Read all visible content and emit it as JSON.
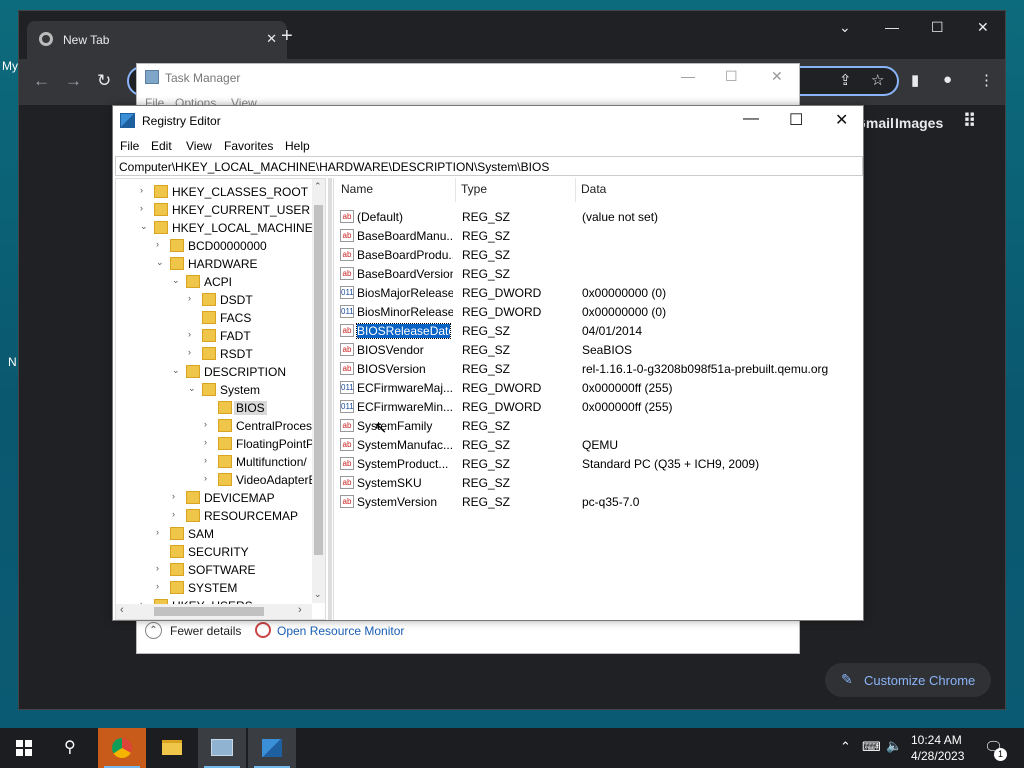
{
  "desktop": {
    "left_fragments": [
      "My",
      "N"
    ]
  },
  "chrome": {
    "tab_title": "New Tab",
    "tab_close": "✕",
    "new_tab": "+",
    "links": [
      "Gmail",
      "Images"
    ],
    "customize_label": "Customize Chrome"
  },
  "task_manager": {
    "title": "Task Manager",
    "menu": [
      "File",
      "Options",
      "View"
    ],
    "fewer_details": "Fewer details",
    "open_resource_monitor": "Open Resource Monitor"
  },
  "regedit": {
    "title": "Registry Editor",
    "menu": [
      "File",
      "Edit",
      "View",
      "Favorites",
      "Help"
    ],
    "address": "Computer\\HKEY_LOCAL_MACHINE\\HARDWARE\\DESCRIPTION\\System\\BIOS",
    "tree": [
      {
        "label": "HKEY_CLASSES_ROOT",
        "exp": "›"
      },
      {
        "label": "HKEY_CURRENT_USER",
        "exp": "›"
      },
      {
        "label": "HKEY_LOCAL_MACHINE",
        "exp": "⌄"
      },
      {
        "label": "BCD00000000",
        "exp": "›"
      },
      {
        "label": "HARDWARE",
        "exp": "⌄"
      },
      {
        "label": "ACPI",
        "exp": "⌄"
      },
      {
        "label": "DSDT",
        "exp": "›"
      },
      {
        "label": "FACS",
        "exp": ""
      },
      {
        "label": "FADT",
        "exp": "›"
      },
      {
        "label": "RSDT",
        "exp": "›"
      },
      {
        "label": "DESCRIPTION",
        "exp": "⌄"
      },
      {
        "label": "System",
        "exp": "⌄"
      },
      {
        "label": "BIOS",
        "exp": ""
      },
      {
        "label": "CentralProcess",
        "exp": "›"
      },
      {
        "label": "FloatingPointP",
        "exp": "›"
      },
      {
        "label": "Multifunction/",
        "exp": "›"
      },
      {
        "label": "VideoAdapterB",
        "exp": "›"
      },
      {
        "label": "DEVICEMAP",
        "exp": "›"
      },
      {
        "label": "RESOURCEMAP",
        "exp": "›"
      },
      {
        "label": "SAM",
        "exp": "›"
      },
      {
        "label": "SECURITY",
        "exp": ""
      },
      {
        "label": "SOFTWARE",
        "exp": "›"
      },
      {
        "label": "SYSTEM",
        "exp": "›"
      },
      {
        "label": "HKEY_USERS",
        "exp": "›"
      }
    ],
    "columns": {
      "name": "Name",
      "type": "Type",
      "data": "Data"
    },
    "values": [
      {
        "name": "(Default)",
        "type": "REG_SZ",
        "data": "(value not set)",
        "icon": "ab"
      },
      {
        "name": "BaseBoardManu...",
        "type": "REG_SZ",
        "data": "",
        "icon": "ab"
      },
      {
        "name": "BaseBoardProdu...",
        "type": "REG_SZ",
        "data": "",
        "icon": "ab"
      },
      {
        "name": "BaseBoardVersion",
        "type": "REG_SZ",
        "data": "",
        "icon": "ab"
      },
      {
        "name": "BiosMajorRelease",
        "type": "REG_DWORD",
        "data": "0x00000000 (0)",
        "icon": "011"
      },
      {
        "name": "BiosMinorRelease",
        "type": "REG_DWORD",
        "data": "0x00000000 (0)",
        "icon": "011"
      },
      {
        "name": "BIOSReleaseDate",
        "type": "REG_SZ",
        "data": "04/01/2014",
        "icon": "ab"
      },
      {
        "name": "BIOSVendor",
        "type": "REG_SZ",
        "data": "SeaBIOS",
        "icon": "ab"
      },
      {
        "name": "BIOSVersion",
        "type": "REG_SZ",
        "data": "rel-1.16.1-0-g3208b098f51a-prebuilt.qemu.org",
        "icon": "ab"
      },
      {
        "name": "ECFirmwareMaj...",
        "type": "REG_DWORD",
        "data": "0x000000ff (255)",
        "icon": "011"
      },
      {
        "name": "ECFirmwareMin...",
        "type": "REG_DWORD",
        "data": "0x000000ff (255)",
        "icon": "011"
      },
      {
        "name": "SystemFamily",
        "type": "REG_SZ",
        "data": "",
        "icon": "ab"
      },
      {
        "name": "SystemManufac...",
        "type": "REG_SZ",
        "data": "QEMU",
        "icon": "ab"
      },
      {
        "name": "SystemProduct...",
        "type": "REG_SZ",
        "data": "Standard PC (Q35 + ICH9, 2009)",
        "icon": "ab"
      },
      {
        "name": "SystemSKU",
        "type": "REG_SZ",
        "data": "",
        "icon": "ab"
      },
      {
        "name": "SystemVersion",
        "type": "REG_SZ",
        "data": "pc-q35-7.0",
        "icon": "ab"
      }
    ],
    "selected_value": "BIOSReleaseDate"
  },
  "taskbar": {
    "time": "10:24 AM",
    "date": "4/28/2023",
    "notification_count": "1"
  },
  "colors": {
    "selection": "#0a64c8",
    "chrome_bg": "#202124",
    "accent": "#8ab4f8"
  }
}
